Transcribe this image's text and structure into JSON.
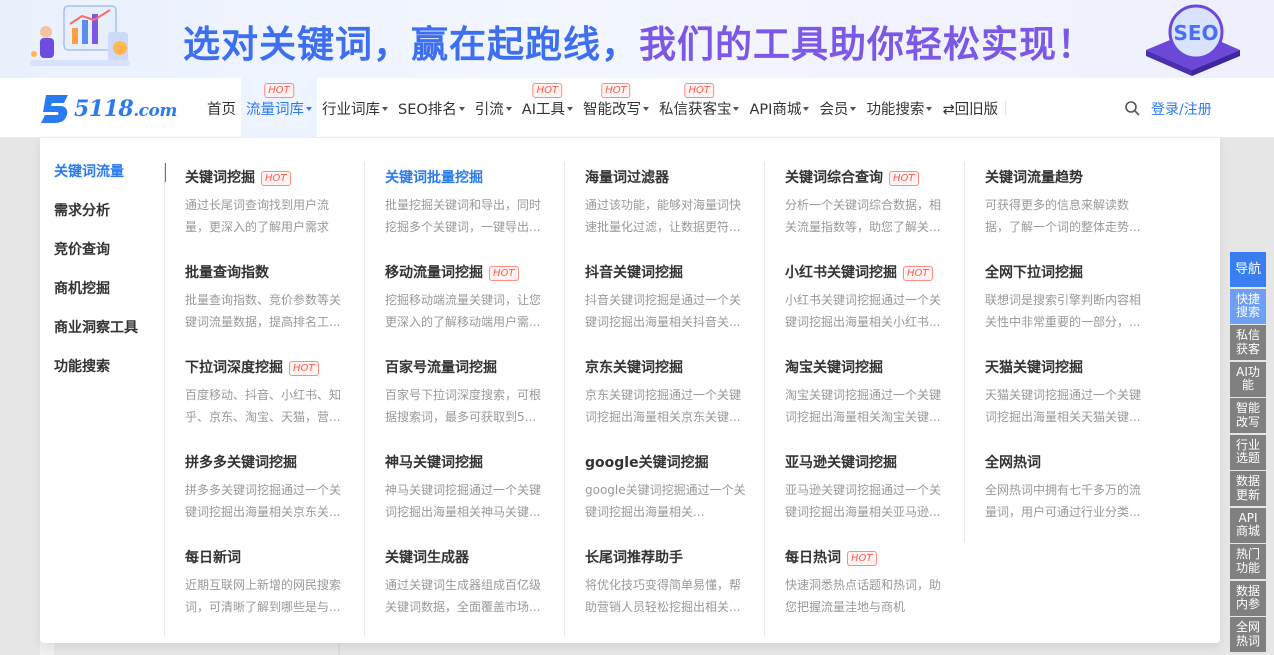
{
  "banner": {
    "slogan_part1": "选对关键词，赢在起跑线，",
    "slogan_part2": "我们的工具助你轻松实现！",
    "badge_text": "SEO"
  },
  "logo": {
    "text": "5118",
    "suffix": ".com"
  },
  "nav": {
    "items": [
      {
        "label": "首页",
        "caret": false,
        "hot": false
      },
      {
        "label": "流量词库",
        "caret": true,
        "hot": true,
        "active": true
      },
      {
        "label": "行业词库",
        "caret": true,
        "hot": false
      },
      {
        "label": "SEO排名",
        "caret": true,
        "hot": false
      },
      {
        "label": "引流",
        "caret": true,
        "hot": false
      },
      {
        "label": "AI工具",
        "caret": true,
        "hot": true
      },
      {
        "label": "智能改写",
        "caret": true,
        "hot": true
      },
      {
        "label": "私信获客宝",
        "caret": true,
        "hot": true
      },
      {
        "label": "API商城",
        "caret": true,
        "hot": false
      },
      {
        "label": "会员",
        "caret": true,
        "hot": false
      },
      {
        "label": "功能搜索",
        "caret": true,
        "hot": false
      },
      {
        "label": "⇄回旧版",
        "caret": false,
        "hot": false
      }
    ],
    "hot_label": "HOT",
    "login": "登录/注册"
  },
  "sidebar": {
    "items": [
      "关键词流量",
      "需求分析",
      "竞价查询",
      "商机挖掘",
      "商业洞察工具",
      "功能搜索"
    ]
  },
  "tools": [
    {
      "title": "关键词挖掘",
      "hot": true,
      "desc": "通过长尾词查询找到用户流量，更深入的了解用户需求"
    },
    {
      "title": "关键词批量挖掘",
      "hot": false,
      "blue": true,
      "desc": "批量挖掘关键词和导出，同时挖掘多个关键词，一键导出..."
    },
    {
      "title": "海量词过滤器",
      "hot": false,
      "desc": "通过该功能，能够对海量词快速批量化过滤，让数据更符..."
    },
    {
      "title": "关键词综合查询",
      "hot": true,
      "desc": "分析一个关键词综合数据，相关流量指数等，助您了解关..."
    },
    {
      "title": "关键词流量趋势",
      "hot": false,
      "desc": "可获得更多的信息来解读数据，了解一个词的整体走势..."
    },
    {
      "title": "批量查询指数",
      "hot": false,
      "desc": "批量查询指数、竞价参数等关键词流量数据，提高排名工..."
    },
    {
      "title": "移动流量词挖掘",
      "hot": true,
      "desc": "挖掘移动端流量关键词，让您更深入的了解移动端用户需..."
    },
    {
      "title": "抖音关键词挖掘",
      "hot": false,
      "desc": "抖音关键词挖掘是通过一个关键词挖掘出海量相关抖音关..."
    },
    {
      "title": "小红书关键词挖掘",
      "hot": true,
      "desc": "小红书关键词挖掘通过一个关键词挖掘出海量相关小红书..."
    },
    {
      "title": "全网下拉词挖掘",
      "hot": false,
      "desc": "联想词是搜索引擎判断内容相关性中非常重要的一部分，..."
    },
    {
      "title": "下拉词深度挖掘",
      "hot": true,
      "desc": "百度移动、抖音、小红书、知乎、京东、淘宝、天猫，营..."
    },
    {
      "title": "百家号流量词挖掘",
      "hot": false,
      "desc": "百家号下拉词深度搜索，可根据搜索词，最多可获取到5..."
    },
    {
      "title": "京东关键词挖掘",
      "hot": false,
      "desc": "京东关键词挖掘通过一个关键词挖掘出海量相关京东关键..."
    },
    {
      "title": "淘宝关键词挖掘",
      "hot": false,
      "desc": "淘宝关键词挖掘通过一个关键词挖掘出海量相关淘宝关键..."
    },
    {
      "title": "天猫关键词挖掘",
      "hot": false,
      "desc": "天猫关键词挖掘通过一个关键词挖掘出海量相关天猫关键..."
    },
    {
      "title": "拼多多关键词挖掘",
      "hot": false,
      "desc": "拼多多关键词挖掘通过一个关键词挖掘出海量相关京东关..."
    },
    {
      "title": "神马关键词挖掘",
      "hot": false,
      "desc": "神马关键词挖掘通过一个关键词挖掘出海量相关神马关键..."
    },
    {
      "title": "google关键词挖掘",
      "hot": false,
      "desc": "google关键词挖掘通过一个关键词挖掘出海量相关..."
    },
    {
      "title": "亚马逊关键词挖掘",
      "hot": false,
      "desc": "亚马逊关键词挖掘通过一个关键词挖掘出海量相关亚马逊..."
    },
    {
      "title": "全网热词",
      "hot": false,
      "desc": "全网热词中拥有七千多万的流量词，用户可通过行业分类..."
    },
    {
      "title": "每日新词",
      "hot": false,
      "desc": "近期互联网上新增的网民搜索词，可清晰了解到哪些是与..."
    },
    {
      "title": "关键词生成器",
      "hot": false,
      "desc": "通过关键词生成器组成百亿级关键词数据，全面覆盖市场..."
    },
    {
      "title": "长尾词推荐助手",
      "hot": false,
      "desc": "将优化技巧变得简单易懂，帮助营销人员轻松挖掘出相关..."
    },
    {
      "title": "每日热词",
      "hot": true,
      "desc": "快速洞悉热点话题和热词，助您把握流量洼地与商机"
    }
  ],
  "float_bar": [
    "导航",
    "快捷搜索",
    "私信获客",
    "AI功能",
    "智能改写",
    "行业选题",
    "数据更新",
    "API商城",
    "热门功能",
    "数据内参",
    "全网热词"
  ]
}
